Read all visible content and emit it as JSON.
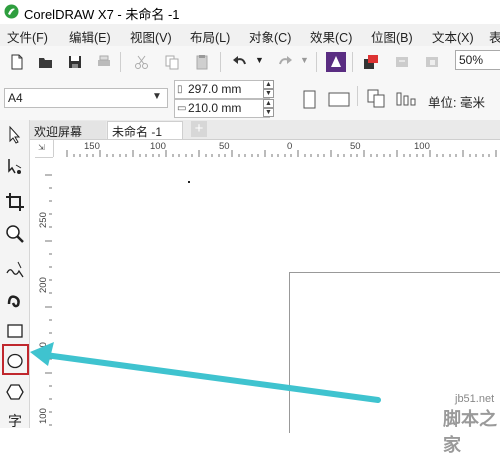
{
  "window": {
    "title": "CorelDRAW X7 - 未命名 -1"
  },
  "menu": [
    "文件(F)",
    "编辑(E)",
    "视图(V)",
    "布局(L)",
    "对象(C)",
    "效果(C)",
    "位图(B)",
    "文本(X)",
    "表"
  ],
  "toolbar": {
    "zoom": "50%"
  },
  "property_bar": {
    "paper_size": "A4",
    "width": "297.0 mm",
    "height": "210.0 mm",
    "unit_label": "单位:",
    "unit_value": "毫米"
  },
  "tabs": [
    {
      "label": "欢迎屏幕",
      "active": false
    },
    {
      "label": "未命名 -1",
      "active": true
    }
  ],
  "ruler": {
    "top_labels": [
      "150",
      "100",
      "50",
      "0",
      "50",
      "100"
    ],
    "left_labels": [
      "250",
      "200",
      "150",
      "100"
    ]
  },
  "watermark": {
    "line1": "jb51.net",
    "line2": "脚本之家"
  },
  "colors": {
    "arrow": "#3fc3cf",
    "highlight": "#c0272d"
  },
  "tools": [
    "pick-tool",
    "shape-tool",
    "crop-tool",
    "zoom-tool",
    "freehand-tool",
    "artistic-media-tool",
    "rectangle-tool",
    "ellipse-tool",
    "polygon-tool",
    "text-tool"
  ]
}
